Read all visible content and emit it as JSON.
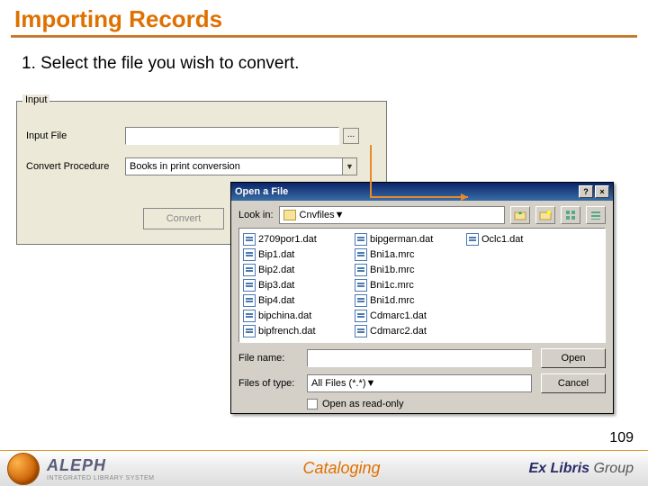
{
  "slide": {
    "title": "Importing Records",
    "instruction": "1. Select the file you wish to convert.",
    "page_number": "109"
  },
  "input_panel": {
    "group_label": "Input",
    "input_file_label": "Input File",
    "input_file_value": "",
    "browse_dots": "...",
    "convert_proc_label": "Convert Procedure",
    "convert_proc_value": "Books in print conversion",
    "convert_button": "Convert"
  },
  "file_dialog": {
    "title": "Open a File",
    "help_btn": "?",
    "close_btn": "×",
    "look_in_label": "Look in:",
    "look_in_value": "Cnvfiles",
    "files_col1": [
      "2709por1.dat",
      "Bip1.dat",
      "Bip2.dat",
      "Bip3.dat",
      "Bip4.dat",
      "bipchina.dat"
    ],
    "files_col2": [
      "bipfrench.dat",
      "bipgerman.dat",
      "Bni1a.mrc",
      "Bni1b.mrc",
      "Bni1c.mrc",
      "Bni1d.mrc"
    ],
    "files_col3": [
      "Cdmarc1.dat",
      "Cdmarc2.dat",
      "Oclc1.dat"
    ],
    "file_name_label": "File name:",
    "file_name_value": "",
    "files_of_type_label": "Files of type:",
    "files_of_type_value": "All Files (*.*)",
    "open_btn": "Open",
    "cancel_btn": "Cancel",
    "readonly_label": "Open as read-only"
  },
  "footer": {
    "aleph": "ALEPH",
    "aleph_sub": "INTEGRATED LIBRARY SYSTEM",
    "center": "Cataloging",
    "exlibris": "Ex Libris",
    "group": " Group"
  }
}
